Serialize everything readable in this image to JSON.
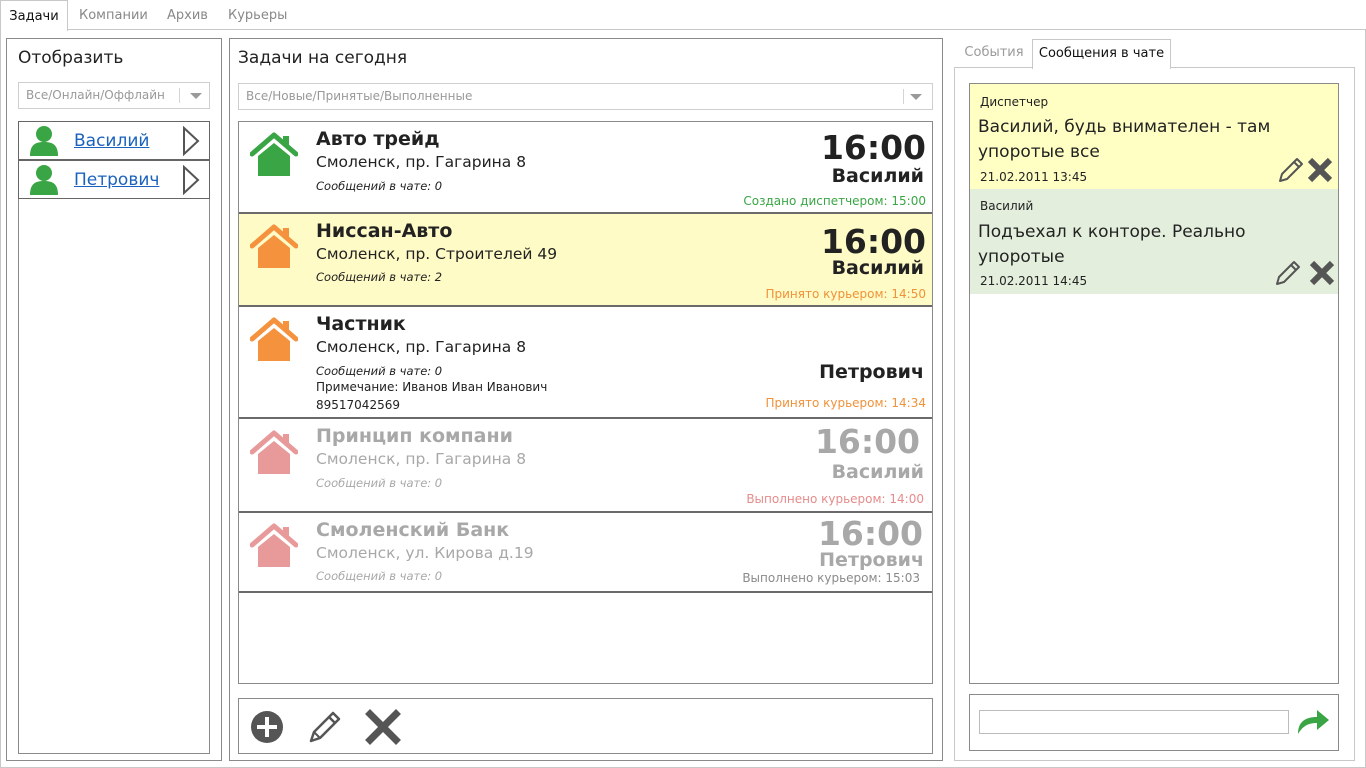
{
  "top_tabs": [
    {
      "label": "Задачи",
      "active": true
    },
    {
      "label": "Компании",
      "active": false
    },
    {
      "label": "Архив",
      "active": false
    },
    {
      "label": "Курьеры",
      "active": false
    }
  ],
  "left_panel": {
    "title": "Отобразить",
    "filter": "Все/Онлайн/Оффлайн",
    "couriers": [
      {
        "name": "Василий",
        "icon": "user-icon"
      },
      {
        "name": "Петрович",
        "icon": "user-icon"
      }
    ]
  },
  "center_panel": {
    "title": "Задачи на сегодня",
    "filter": "Все/Новые/Принятые/Выполненные",
    "tasks": [
      {
        "title": "Авто трейд",
        "address": "Смоленск, пр. Гагарина 8",
        "messages": "Сообщений в чате: 0",
        "note": "",
        "phone": "",
        "time": "16:00",
        "courier": "Василий",
        "status": "Создано диспетчером: 15:00",
        "status_color": "#3aa544",
        "house_color": "#3aa544",
        "background": "#ffffff"
      },
      {
        "title": "Ниссан-Авто",
        "address": "Смоленск, пр. Строителей 49",
        "messages": "Сообщений в чате: 2",
        "note": "",
        "phone": "",
        "time": "16:00",
        "courier": "Василий",
        "status": "Принято курьером: 14:50",
        "status_color": "#f0923a",
        "house_color": "#f5923e",
        "background": "#fffbc6"
      },
      {
        "title": "Частник",
        "address": "Смоленск, пр. Гагарина 8",
        "messages": "Сообщений в чате: 0",
        "note": "Примечание: Иванов Иван Иванович",
        "phone": "89517042569",
        "time": "",
        "courier": "Петрович",
        "status": "Принято курьером: 14:34",
        "status_color": "#f0923a",
        "house_color": "#f5923e",
        "background": "#ffffff"
      },
      {
        "title": "Принцип компани",
        "address": "Смоленск, пр. Гагарина 8",
        "messages": "Сообщений в чате: 0",
        "note": "",
        "phone": "",
        "time": "16:00",
        "courier": "Василий",
        "status": "Выполнено курьером: 14:00",
        "status_color": "#e58c8c",
        "house_color": "#e89a9a",
        "background": "#ffffff"
      },
      {
        "title": "Смоленский Банк",
        "address": "Смоленск, ул. Кирова д.19",
        "messages": "Сообщений в чате: 0",
        "note": "",
        "phone": "",
        "time": "16:00",
        "courier": "Петрович",
        "status": "Выполнено курьером: 15:03",
        "status_color": "#8a8a8a",
        "house_color": "#e89a9a",
        "background": "#ffffff"
      }
    ],
    "toolbar": [
      {
        "name": "add-button",
        "icon": "plus-icon"
      },
      {
        "name": "edit-button",
        "icon": "pencil-icon"
      },
      {
        "name": "delete-button",
        "icon": "close-icon"
      }
    ]
  },
  "right_panel": {
    "tabs": [
      {
        "label": "События",
        "active": false
      },
      {
        "label": "Сообщения в чате",
        "active": true
      }
    ],
    "messages": [
      {
        "author": "Диспетчер",
        "text": "Василий, будь внимателен - там упоротые все",
        "date": "21.02.2011 13:45",
        "background": "#ffffc4"
      },
      {
        "author": "Василий",
        "text": "Подъехал к конторе. Реально упоротые",
        "date": "21.02.2011 14:45",
        "background": "#e3efdc"
      }
    ],
    "input": {
      "value": "",
      "placeholder": ""
    },
    "send_icon": "send-arrow-icon"
  },
  "colors": {
    "accent_link": "#1b62bd",
    "online_green": "#3aa544",
    "icon_gray": "#555555"
  }
}
